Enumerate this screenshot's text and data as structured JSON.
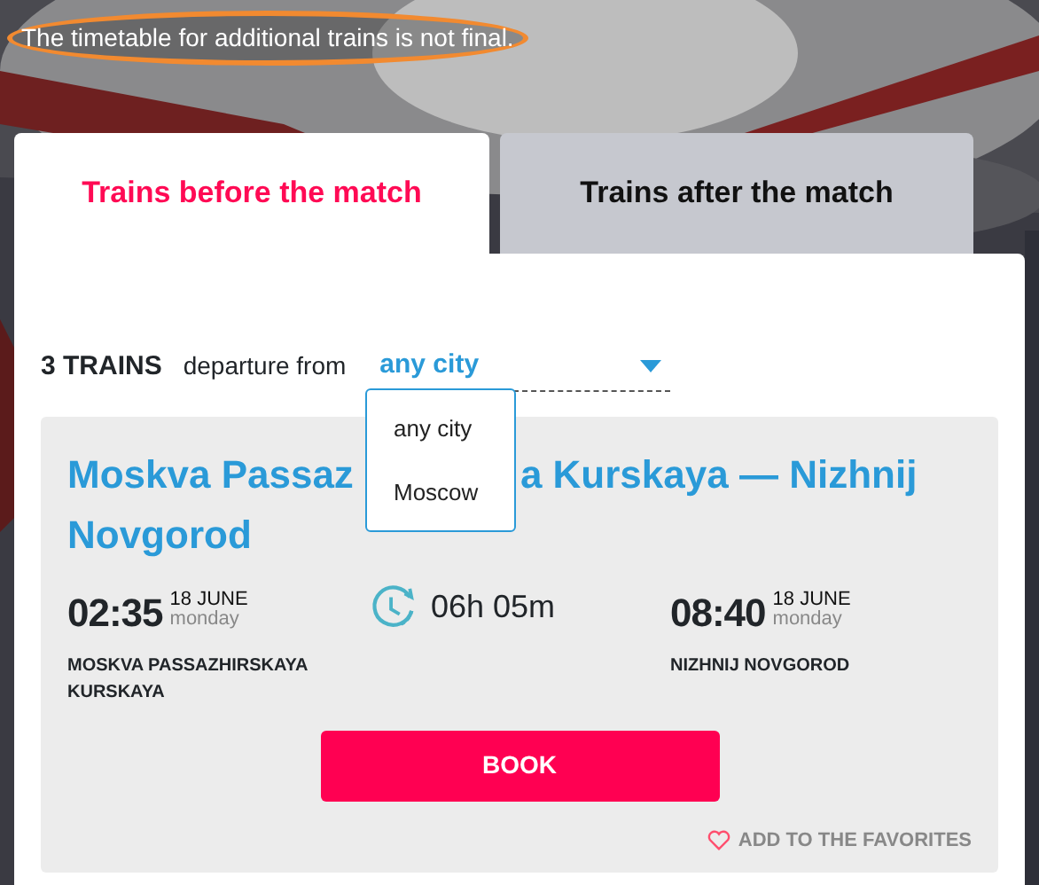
{
  "notice": "The timetable for additional trains is not final.",
  "tabs": [
    {
      "label": "Trains before the match",
      "selected": true
    },
    {
      "label": "Trains after the match",
      "selected": false
    }
  ],
  "filter": {
    "count": "3 TRAINS",
    "label": "departure from",
    "value": "any city",
    "expanded": true,
    "options": [
      "any city",
      "Moscow"
    ]
  },
  "trains": [
    {
      "title_parts": [
        "Moskva Passaz",
        "a Kurskaya — Nizhnij Novgorod"
      ],
      "departure": {
        "time": "02:35",
        "date": "18 JUNE",
        "weekday": "monday",
        "station": "MOSKVA PASSAZHIRSKAYA KURSKAYA"
      },
      "duration": "06h 05m",
      "arrival": {
        "time": "08:40",
        "date": "18 JUNE",
        "weekday": "monday",
        "station": "NIZHNIJ NOVGOROD"
      },
      "book": "BOOK",
      "favorite": "ADD TO THE FAVORITES"
    }
  ]
}
